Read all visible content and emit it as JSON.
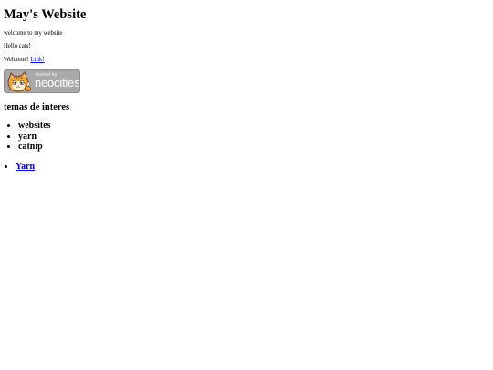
{
  "page": {
    "title": "May's Website",
    "intro": "welcome to my website",
    "greeting": "Hello cats!",
    "welcome_prefix": "Welcome!",
    "welcome_link": "Link!"
  },
  "badge": {
    "small_text": "hosted by",
    "big_text": "neocities",
    "icon": "neocities-cat-icon"
  },
  "topics": {
    "heading": "temas de interes",
    "items": [
      "websites",
      "yarn",
      "catnip"
    ]
  },
  "links": {
    "items": [
      "Yarn"
    ]
  },
  "colors": {
    "link": "#0000ee",
    "badge_bg": "#a9a9a9"
  }
}
